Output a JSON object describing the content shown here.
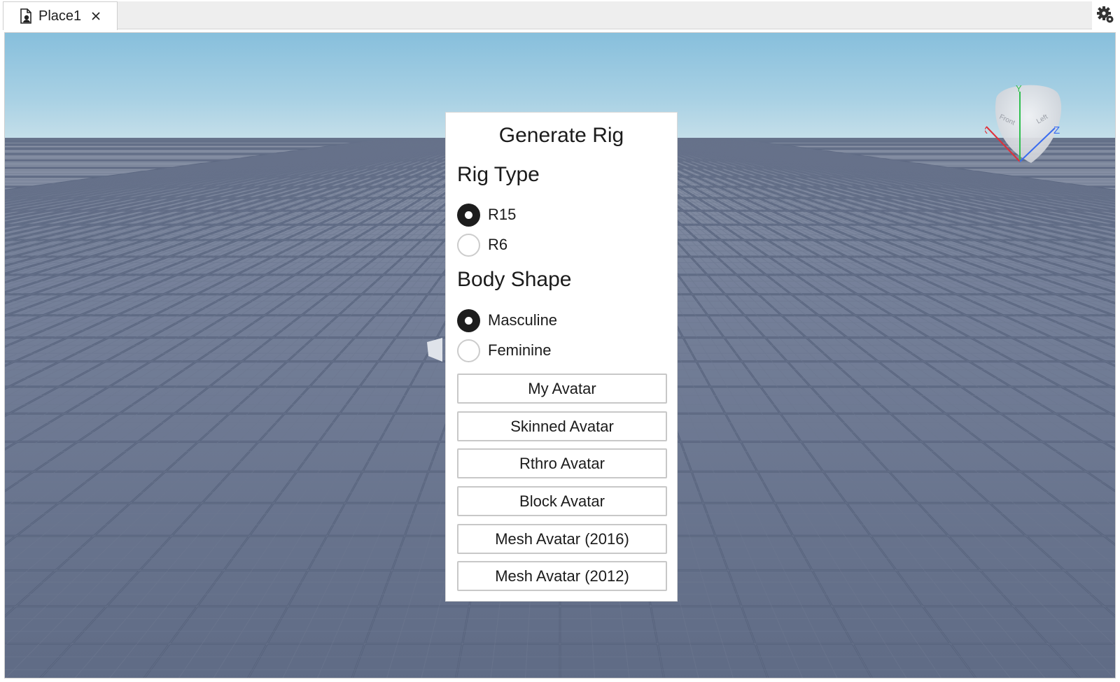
{
  "tabs": [
    {
      "label": "Place1",
      "icon": "place-file-icon",
      "close_icon": "close-icon"
    }
  ],
  "toolbar": {
    "settings_icon": "gear-icon"
  },
  "dialog": {
    "title": "Generate Rig",
    "rig_type": {
      "heading": "Rig Type",
      "options": [
        {
          "label": "R15",
          "selected": true
        },
        {
          "label": "R6",
          "selected": false
        }
      ]
    },
    "body_shape": {
      "heading": "Body Shape",
      "options": [
        {
          "label": "Masculine",
          "selected": true
        },
        {
          "label": "Feminine",
          "selected": false
        }
      ]
    },
    "buttons": [
      "My Avatar",
      "Skinned Avatar",
      "Rthro Avatar",
      "Block Avatar",
      "Mesh Avatar (2016)",
      "Mesh Avatar (2012)"
    ]
  },
  "view_cube": {
    "axes": {
      "x": "X",
      "y": "Y",
      "z": "Z"
    },
    "faces": {
      "front": "Front",
      "left": "Left"
    },
    "colors": {
      "x": "#e0303a",
      "y": "#2fbf4f",
      "z": "#3a6cf0"
    }
  },
  "colors": {
    "sky_top": "#87bfdc",
    "ground": "#6b7790",
    "grid_line": "#5a6580"
  }
}
